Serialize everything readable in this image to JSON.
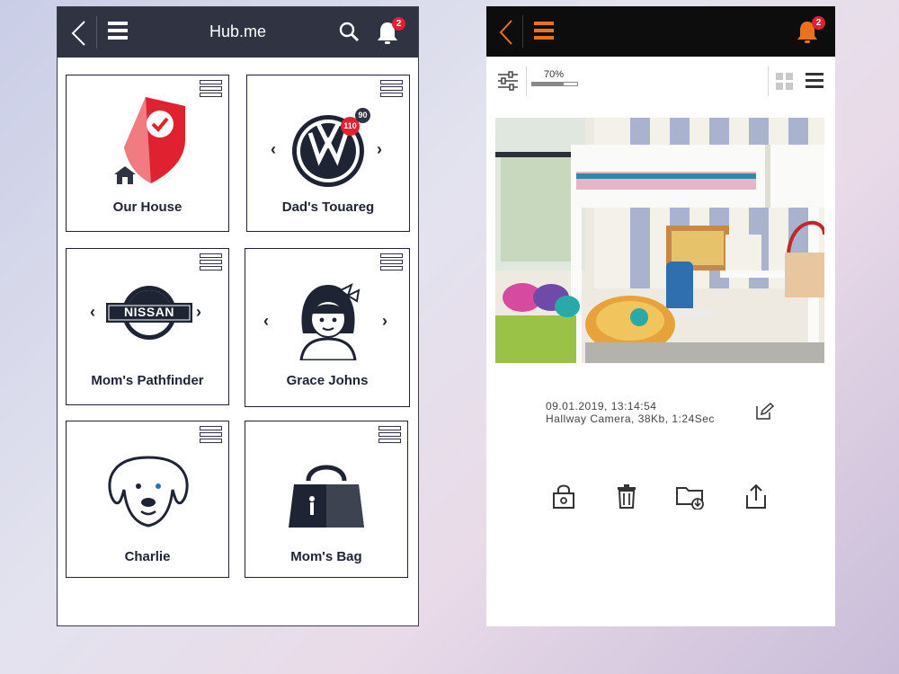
{
  "hub": {
    "title": "Hub.me",
    "notifications": "2",
    "cards": [
      {
        "label": "Our House"
      },
      {
        "label": "Dad's Touareg",
        "badge_primary": "110",
        "badge_secondary": "90"
      },
      {
        "label": "Mom's Pathfinder",
        "logo_text": "NISSAN"
      },
      {
        "label": "Grace Johns"
      },
      {
        "label": "Charlie"
      },
      {
        "label": "Mom's Bag"
      }
    ]
  },
  "viewer": {
    "notifications": "2",
    "zoom": "70%",
    "zoom_fraction": 0.7,
    "timestamp": "09.01.2019,  13:14:54",
    "details": "Hallway Camera, 38Kb, 1:24Sec"
  },
  "colors": {
    "accent": "#e8731c",
    "badge": "#e0212f",
    "header_dark": "#2f3342",
    "header_black": "#0d0d0d",
    "shield_red": "#e0212f"
  },
  "icons": {
    "back": "chevron-left-icon",
    "menu": "hamburger-icon",
    "search": "search-icon",
    "bell": "bell-icon",
    "card_menu": "card-menu-icon",
    "filter": "sliders-icon",
    "grid": "grid-view-icon",
    "list": "list-view-icon",
    "edit": "edit-icon",
    "lock": "lock-icon",
    "trash": "trash-icon",
    "folder": "folder-download-icon",
    "share": "share-icon"
  }
}
